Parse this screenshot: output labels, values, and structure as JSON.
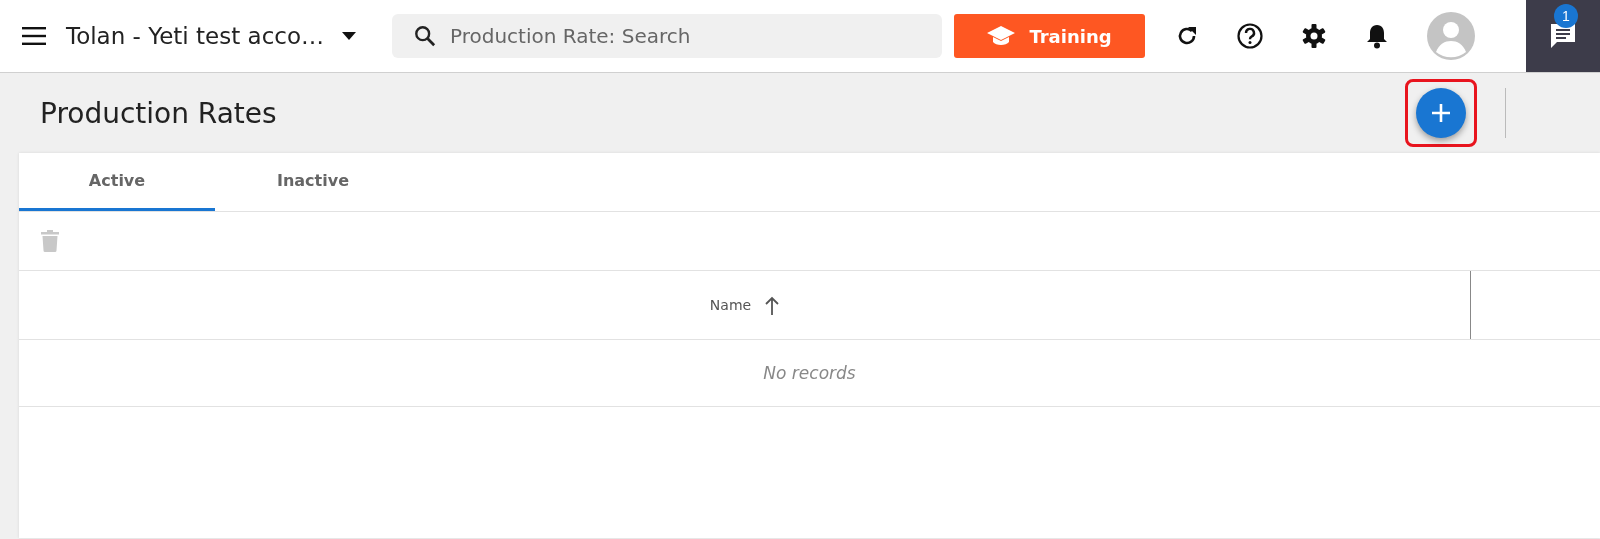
{
  "header": {
    "account": "Tolan - Yeti test acco…",
    "search": {
      "placeholder": "Production Rate: Search"
    },
    "training_button": "Training",
    "chat_badge": "1"
  },
  "page": {
    "title": "Production Rates",
    "add_button_highlighted": true
  },
  "tabs": [
    {
      "label": "Active",
      "selected": true
    },
    {
      "label": "Inactive",
      "selected": false
    }
  ],
  "table": {
    "columns": [
      {
        "label": "Name",
        "sort_ascending": true
      }
    ],
    "empty_message": "No records"
  }
}
